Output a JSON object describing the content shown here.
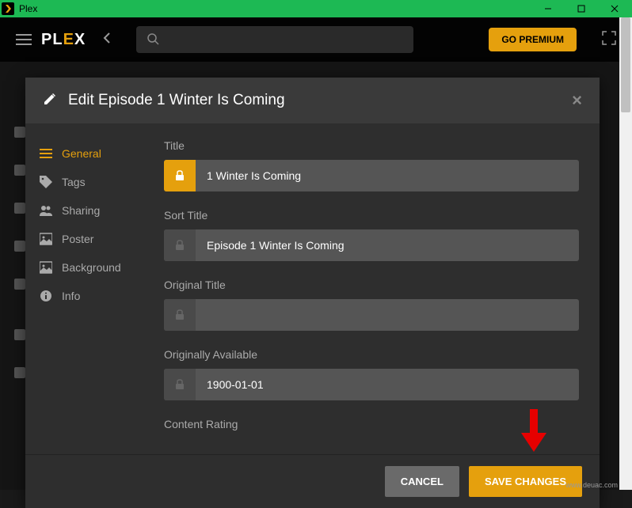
{
  "window": {
    "app_title": "Plex"
  },
  "header": {
    "logo_prefix": "PL",
    "logo_accent": "E",
    "logo_suffix": "X",
    "go_premium": "GO PREMIUM"
  },
  "modal": {
    "title": "Edit Episode 1 Winter Is Coming",
    "sidebar": {
      "items": [
        {
          "label": "General",
          "active": true
        },
        {
          "label": "Tags"
        },
        {
          "label": "Sharing"
        },
        {
          "label": "Poster"
        },
        {
          "label": "Background"
        },
        {
          "label": "Info"
        }
      ]
    },
    "form": {
      "title": {
        "label": "Title",
        "value": "1 Winter Is Coming",
        "locked": true
      },
      "sort_title": {
        "label": "Sort Title",
        "value": "Episode 1 Winter Is Coming",
        "locked": false
      },
      "original_title": {
        "label": "Original Title",
        "value": "",
        "locked": false
      },
      "originally_available": {
        "label": "Originally Available",
        "value": "1900-01-01",
        "locked": false
      },
      "content_rating": {
        "label": "Content Rating",
        "value": "",
        "locked": false
      }
    },
    "footer": {
      "cancel": "CANCEL",
      "save": "SAVE CHANGES"
    }
  },
  "watermark": "www.deuac.com"
}
